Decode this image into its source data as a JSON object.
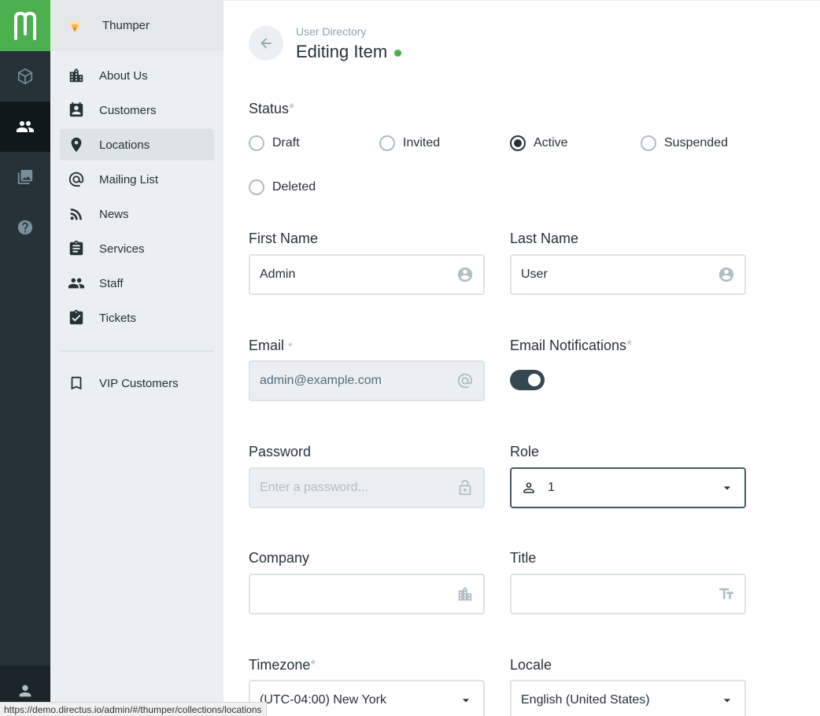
{
  "project": {
    "name": "Thumper"
  },
  "modules": [
    {
      "name": "Collections",
      "icon": "box-icon"
    },
    {
      "name": "User Directory",
      "icon": "people-icon",
      "active": true
    },
    {
      "name": "File Library",
      "icon": "photo-library-icon"
    },
    {
      "name": "Help",
      "icon": "help-icon"
    }
  ],
  "nav": {
    "items": [
      {
        "label": "About Us",
        "icon": "building-icon"
      },
      {
        "label": "Customers",
        "icon": "contact-card-icon"
      },
      {
        "label": "Locations",
        "icon": "place-pin-icon",
        "active": true
      },
      {
        "label": "Mailing List",
        "icon": "at-sign-icon"
      },
      {
        "label": "News",
        "icon": "rss-icon"
      },
      {
        "label": "Services",
        "icon": "clipboard-icon"
      },
      {
        "label": "Staff",
        "icon": "people-icon"
      },
      {
        "label": "Tickets",
        "icon": "assignment-check-icon"
      }
    ],
    "bookmarks": [
      {
        "label": "VIP Customers",
        "icon": "bookmark-icon"
      }
    ]
  },
  "header": {
    "breadcrumb": "User Directory",
    "title": "Editing Item",
    "status_color": "#4caf50"
  },
  "form": {
    "status": {
      "label": "Status",
      "required_mark": "*",
      "options": [
        "Draft",
        "Invited",
        "Active",
        "Suspended",
        "Deleted"
      ],
      "selected": "Active"
    },
    "first_name": {
      "label": "First Name",
      "value": "Admin"
    },
    "last_name": {
      "label": "Last Name",
      "value": "User"
    },
    "email": {
      "label": "Email",
      "required_mark": "*",
      "value": "admin@example.com"
    },
    "email_notifications": {
      "label": "Email Notifications",
      "required_mark": "*",
      "enabled": true
    },
    "password": {
      "label": "Password",
      "placeholder": "Enter a password..."
    },
    "role": {
      "label": "Role",
      "value": "1"
    },
    "company": {
      "label": "Company",
      "value": ""
    },
    "title": {
      "label": "Title",
      "value": ""
    },
    "timezone": {
      "label": "Timezone",
      "required_mark": "*",
      "value": "(UTC-04:00) New York"
    },
    "locale": {
      "label": "Locale",
      "value": "English (United States)"
    }
  },
  "statusbar": {
    "url": "https://demo.directus.io/admin/#/thumper/collections/locations"
  },
  "colors": {
    "accent": "#4caf50",
    "sidebar": "#263238",
    "nav": "#eceff1"
  }
}
